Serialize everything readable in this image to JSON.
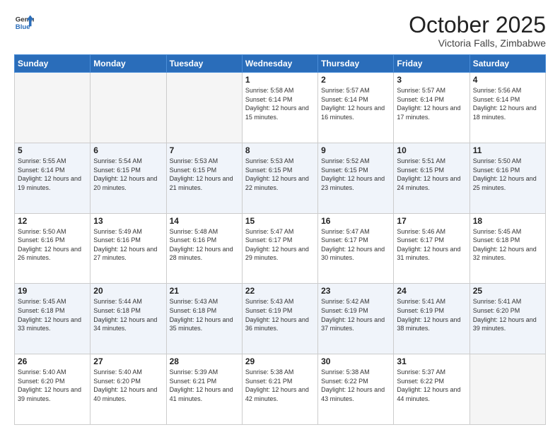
{
  "header": {
    "logo_line1": "General",
    "logo_line2": "Blue",
    "month_title": "October 2025",
    "subtitle": "Victoria Falls, Zimbabwe"
  },
  "weekdays": [
    "Sunday",
    "Monday",
    "Tuesday",
    "Wednesday",
    "Thursday",
    "Friday",
    "Saturday"
  ],
  "weeks": [
    [
      {
        "day": "",
        "empty": true
      },
      {
        "day": "",
        "empty": true
      },
      {
        "day": "",
        "empty": true
      },
      {
        "day": "1",
        "sunrise": "5:58 AM",
        "sunset": "6:14 PM",
        "daylight": "12 hours and 15 minutes."
      },
      {
        "day": "2",
        "sunrise": "5:57 AM",
        "sunset": "6:14 PM",
        "daylight": "12 hours and 16 minutes."
      },
      {
        "day": "3",
        "sunrise": "5:57 AM",
        "sunset": "6:14 PM",
        "daylight": "12 hours and 17 minutes."
      },
      {
        "day": "4",
        "sunrise": "5:56 AM",
        "sunset": "6:14 PM",
        "daylight": "12 hours and 18 minutes."
      }
    ],
    [
      {
        "day": "5",
        "sunrise": "5:55 AM",
        "sunset": "6:14 PM",
        "daylight": "12 hours and 19 minutes."
      },
      {
        "day": "6",
        "sunrise": "5:54 AM",
        "sunset": "6:15 PM",
        "daylight": "12 hours and 20 minutes."
      },
      {
        "day": "7",
        "sunrise": "5:53 AM",
        "sunset": "6:15 PM",
        "daylight": "12 hours and 21 minutes."
      },
      {
        "day": "8",
        "sunrise": "5:53 AM",
        "sunset": "6:15 PM",
        "daylight": "12 hours and 22 minutes."
      },
      {
        "day": "9",
        "sunrise": "5:52 AM",
        "sunset": "6:15 PM",
        "daylight": "12 hours and 23 minutes."
      },
      {
        "day": "10",
        "sunrise": "5:51 AM",
        "sunset": "6:15 PM",
        "daylight": "12 hours and 24 minutes."
      },
      {
        "day": "11",
        "sunrise": "5:50 AM",
        "sunset": "6:16 PM",
        "daylight": "12 hours and 25 minutes."
      }
    ],
    [
      {
        "day": "12",
        "sunrise": "5:50 AM",
        "sunset": "6:16 PM",
        "daylight": "12 hours and 26 minutes."
      },
      {
        "day": "13",
        "sunrise": "5:49 AM",
        "sunset": "6:16 PM",
        "daylight": "12 hours and 27 minutes."
      },
      {
        "day": "14",
        "sunrise": "5:48 AM",
        "sunset": "6:16 PM",
        "daylight": "12 hours and 28 minutes."
      },
      {
        "day": "15",
        "sunrise": "5:47 AM",
        "sunset": "6:17 PM",
        "daylight": "12 hours and 29 minutes."
      },
      {
        "day": "16",
        "sunrise": "5:47 AM",
        "sunset": "6:17 PM",
        "daylight": "12 hours and 30 minutes."
      },
      {
        "day": "17",
        "sunrise": "5:46 AM",
        "sunset": "6:17 PM",
        "daylight": "12 hours and 31 minutes."
      },
      {
        "day": "18",
        "sunrise": "5:45 AM",
        "sunset": "6:18 PM",
        "daylight": "12 hours and 32 minutes."
      }
    ],
    [
      {
        "day": "19",
        "sunrise": "5:45 AM",
        "sunset": "6:18 PM",
        "daylight": "12 hours and 33 minutes."
      },
      {
        "day": "20",
        "sunrise": "5:44 AM",
        "sunset": "6:18 PM",
        "daylight": "12 hours and 34 minutes."
      },
      {
        "day": "21",
        "sunrise": "5:43 AM",
        "sunset": "6:18 PM",
        "daylight": "12 hours and 35 minutes."
      },
      {
        "day": "22",
        "sunrise": "5:43 AM",
        "sunset": "6:19 PM",
        "daylight": "12 hours and 36 minutes."
      },
      {
        "day": "23",
        "sunrise": "5:42 AM",
        "sunset": "6:19 PM",
        "daylight": "12 hours and 37 minutes."
      },
      {
        "day": "24",
        "sunrise": "5:41 AM",
        "sunset": "6:19 PM",
        "daylight": "12 hours and 38 minutes."
      },
      {
        "day": "25",
        "sunrise": "5:41 AM",
        "sunset": "6:20 PM",
        "daylight": "12 hours and 39 minutes."
      }
    ],
    [
      {
        "day": "26",
        "sunrise": "5:40 AM",
        "sunset": "6:20 PM",
        "daylight": "12 hours and 39 minutes."
      },
      {
        "day": "27",
        "sunrise": "5:40 AM",
        "sunset": "6:20 PM",
        "daylight": "12 hours and 40 minutes."
      },
      {
        "day": "28",
        "sunrise": "5:39 AM",
        "sunset": "6:21 PM",
        "daylight": "12 hours and 41 minutes."
      },
      {
        "day": "29",
        "sunrise": "5:38 AM",
        "sunset": "6:21 PM",
        "daylight": "12 hours and 42 minutes."
      },
      {
        "day": "30",
        "sunrise": "5:38 AM",
        "sunset": "6:22 PM",
        "daylight": "12 hours and 43 minutes."
      },
      {
        "day": "31",
        "sunrise": "5:37 AM",
        "sunset": "6:22 PM",
        "daylight": "12 hours and 44 minutes."
      },
      {
        "day": "",
        "empty": true
      }
    ]
  ],
  "labels": {
    "sunrise_prefix": "Sunrise: ",
    "sunset_prefix": "Sunset: ",
    "daylight_prefix": "Daylight: "
  }
}
